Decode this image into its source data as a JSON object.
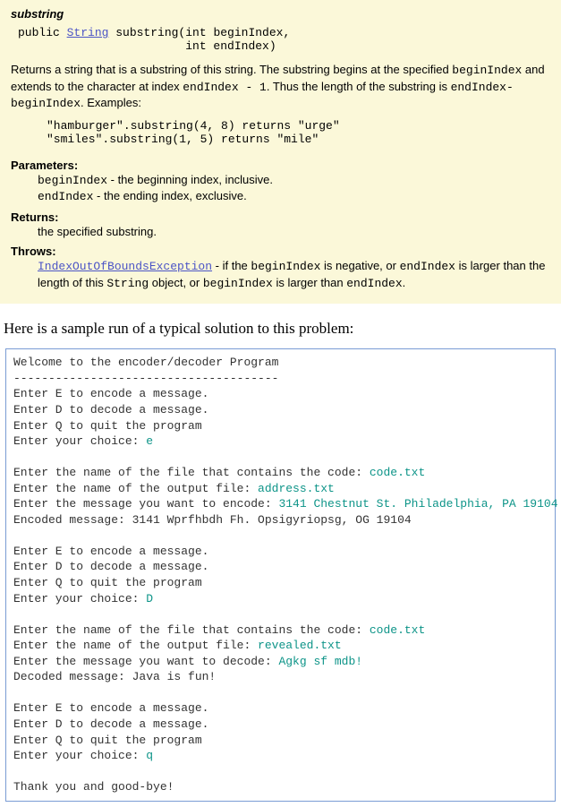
{
  "javadoc": {
    "method": "substring",
    "sig_prefix": "public ",
    "sig_type": "String",
    "sig_rest1": " substring(int beginIndex,",
    "sig_rest2": "                        int endIndex)",
    "desc_a": "Returns a string that is a substring of this string. The substring begins at the specified ",
    "desc_b": "beginIndex",
    "desc_c": " and extends to the character at index ",
    "desc_d": "endIndex - 1",
    "desc_e": ". Thus the length of the substring is ",
    "desc_f": "endIndex-beginIndex",
    "desc_g": ". Examples:",
    "example1": "\"hamburger\".substring(4, 8) returns \"urge\"",
    "example2": "\"smiles\".substring(1, 5) returns \"mile\"",
    "params_label": "Parameters:",
    "param1_code": "beginIndex",
    "param1_text": " - the beginning index, inclusive.",
    "param2_code": "endIndex",
    "param2_text": " - the ending index, exclusive.",
    "returns_label": "Returns:",
    "returns_text": "the specified substring.",
    "throws_label": "Throws:",
    "throws_link": "IndexOutOfBoundsException",
    "throws_a": " - if the ",
    "throws_b": "beginIndex",
    "throws_c": " is negative, or ",
    "throws_d": "endIndex",
    "throws_e": " is larger than the length of this ",
    "throws_f": "String",
    "throws_g": " object, or ",
    "throws_h": "beginIndex",
    "throws_i": " is larger than ",
    "throws_j": "endIndex",
    "throws_k": "."
  },
  "intro": "Here is a sample run of a typical solution to this problem:",
  "run": {
    "l01": "Welcome to the encoder/decoder Program",
    "l02": "--------------------------------------",
    "l03": "Enter E to encode a message.",
    "l04": "Enter D to decode a message.",
    "l05": "Enter Q to quit the program",
    "l06p": "Enter your choice: ",
    "l06i": "e",
    "l07p": "Enter the name of the file that contains the code: ",
    "l07i": "code.txt",
    "l08p": "Enter the name of the output file: ",
    "l08i": "address.txt",
    "l09p": "Enter the message you want to encode: ",
    "l09i": "3141 Chestnut St. Philadelphia, PA 19104",
    "l10": "Encoded message: 3141 Wprfhbdh Fh. Opsigyriopsg, OG 19104",
    "l11": "Enter E to encode a message.",
    "l12": "Enter D to decode a message.",
    "l13": "Enter Q to quit the program",
    "l14p": "Enter your choice: ",
    "l14i": "D",
    "l15p": "Enter the name of the file that contains the code: ",
    "l15i": "code.txt",
    "l16p": "Enter the name of the output file: ",
    "l16i": "revealed.txt",
    "l17p": "Enter the message you want to decode: ",
    "l17i": "Agkg sf mdb!",
    "l18": "Decoded message: Java is fun!",
    "l19": "Enter E to encode a message.",
    "l20": "Enter D to decode a message.",
    "l21": "Enter Q to quit the program",
    "l22p": "Enter your choice: ",
    "l22i": "q",
    "l23": "Thank you and good-bye!"
  }
}
